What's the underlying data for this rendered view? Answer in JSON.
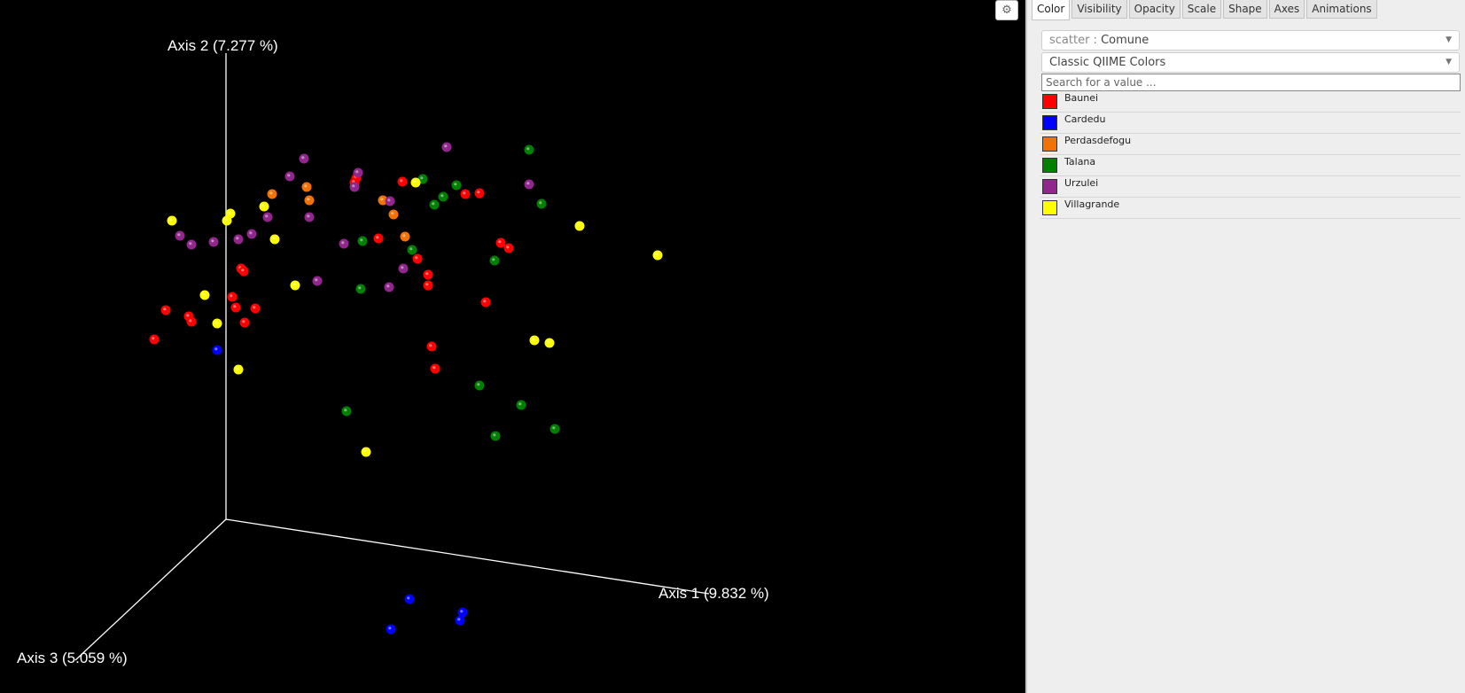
{
  "plot": {
    "axes": {
      "axis1": "Axis 1 (9.832 %)",
      "axis2": "Axis 2 (7.277 %)",
      "axis3": "Axis 3 (5.059 %)"
    },
    "axis_color": "#ffffff",
    "background": "#000000"
  },
  "toolbar": {
    "gear_icon": "gear-icon"
  },
  "tabs": [
    "Color",
    "Visibility",
    "Opacity",
    "Scale",
    "Shape",
    "Axes",
    "Animations"
  ],
  "color_panel": {
    "category_prefix": "scatter : ",
    "category_value": "Comune",
    "colormap": "Classic QIIME Colors",
    "search_placeholder": "Search for a value ...",
    "legend": [
      {
        "label": "Baunei",
        "color": "#ff0000"
      },
      {
        "label": "Cardedu",
        "color": "#0000ff"
      },
      {
        "label": "Perdasdefogu",
        "color": "#f27304"
      },
      {
        "label": "Talana",
        "color": "#008000"
      },
      {
        "label": "Urzulei",
        "color": "#91278d"
      },
      {
        "label": "Villagrande",
        "color": "#ffff00"
      }
    ]
  }
}
